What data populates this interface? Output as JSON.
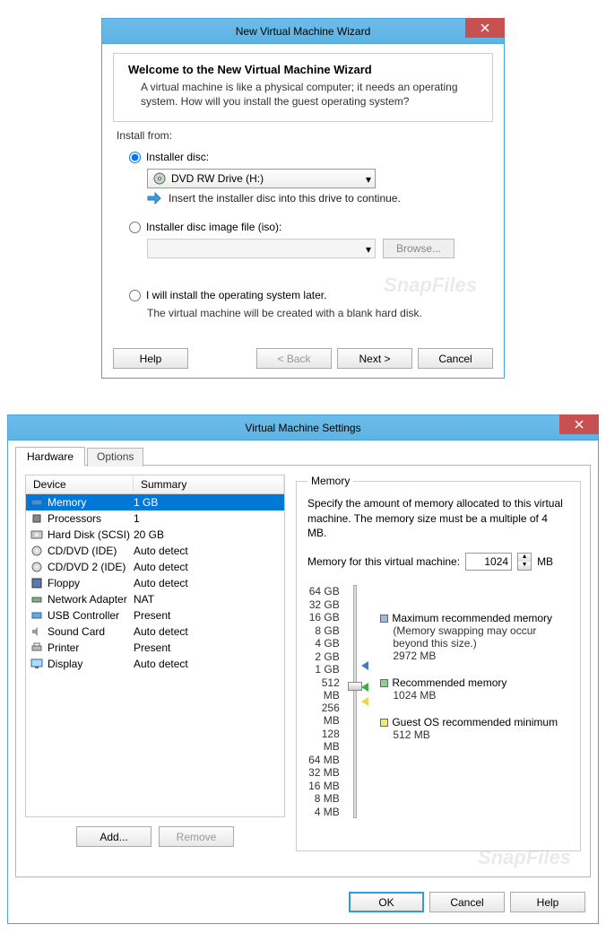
{
  "wizard": {
    "title": "New Virtual Machine Wizard",
    "welcome_title": "Welcome to the New Virtual Machine Wizard",
    "welcome_desc": "A virtual machine is like a physical computer; it needs an operating system. How will you install the guest operating system?",
    "install_from": "Install from:",
    "opt_disc": "Installer disc:",
    "disc_value": "DVD RW Drive (H:)",
    "disc_hint": "Insert the installer disc into this drive to continue.",
    "opt_iso": "Installer disc image file (iso):",
    "browse": "Browse...",
    "opt_later": "I will install the operating system later.",
    "later_desc": "The virtual machine will be created with a blank hard disk.",
    "btn_help": "Help",
    "btn_back": "< Back",
    "btn_next": "Next >",
    "btn_cancel": "Cancel"
  },
  "settings": {
    "title": "Virtual Machine Settings",
    "tab_hardware": "Hardware",
    "tab_options": "Options",
    "col_device": "Device",
    "col_summary": "Summary",
    "devices": [
      {
        "name": "Memory",
        "summary": "1 GB",
        "icon": "memory"
      },
      {
        "name": "Processors",
        "summary": "1",
        "icon": "cpu"
      },
      {
        "name": "Hard Disk (SCSI)",
        "summary": "20 GB",
        "icon": "hdd"
      },
      {
        "name": "CD/DVD (IDE)",
        "summary": "Auto detect",
        "icon": "cd"
      },
      {
        "name": "CD/DVD 2 (IDE)",
        "summary": "Auto detect",
        "icon": "cd"
      },
      {
        "name": "Floppy",
        "summary": "Auto detect",
        "icon": "floppy"
      },
      {
        "name": "Network Adapter",
        "summary": "NAT",
        "icon": "net"
      },
      {
        "name": "USB Controller",
        "summary": "Present",
        "icon": "usb"
      },
      {
        "name": "Sound Card",
        "summary": "Auto detect",
        "icon": "sound"
      },
      {
        "name": "Printer",
        "summary": "Present",
        "icon": "printer"
      },
      {
        "name": "Display",
        "summary": "Auto detect",
        "icon": "display"
      }
    ],
    "btn_add": "Add...",
    "btn_remove": "Remove",
    "memory": {
      "legend": "Memory",
      "desc": "Specify the amount of memory allocated to this virtual machine. The memory size must be a multiple of 4 MB.",
      "label": "Memory for this virtual machine:",
      "value": "1024",
      "unit": "MB",
      "ticks": [
        "64 GB",
        "32 GB",
        "16 GB",
        "8 GB",
        "4 GB",
        "2 GB",
        "1 GB",
        "512 MB",
        "256 MB",
        "128 MB",
        "64 MB",
        "32 MB",
        "16 MB",
        "8 MB",
        "4 MB"
      ],
      "max_label": "Maximum recommended memory",
      "max_note": "(Memory swapping may occur beyond this size.)",
      "max_val": "2972 MB",
      "rec_label": "Recommended memory",
      "rec_val": "1024 MB",
      "min_label": "Guest OS recommended minimum",
      "min_val": "512 MB"
    },
    "btn_ok": "OK",
    "btn_cancel": "Cancel",
    "btn_help": "Help"
  },
  "watermark": "SnapFiles"
}
